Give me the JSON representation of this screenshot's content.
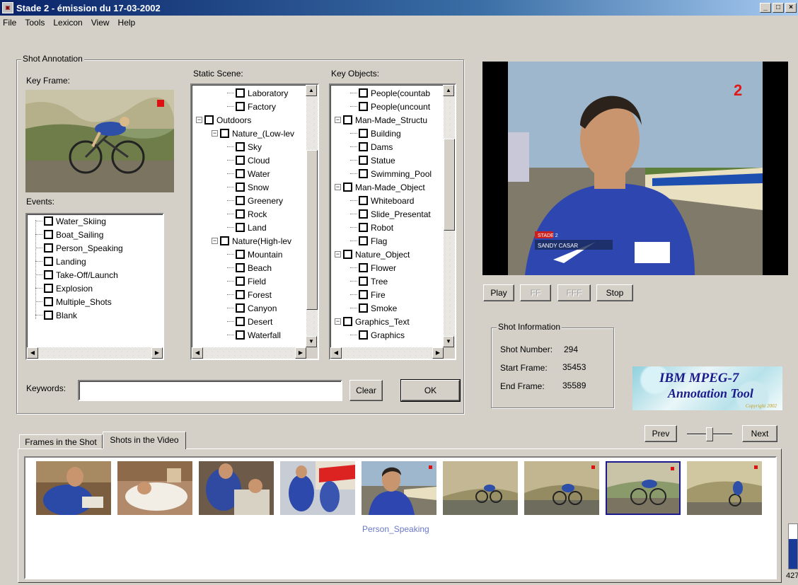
{
  "window": {
    "title": "Stade 2 - émission du 17-03-2002",
    "app_icon": "mpeg7-app-icon",
    "min_label": "_",
    "max_label": "□",
    "close_label": "×"
  },
  "menu": [
    "File",
    "Tools",
    "Lexicon",
    "View",
    "Help"
  ],
  "shot_annotation": {
    "legend": "Shot Annotation",
    "key_frame_label": "Key Frame:",
    "events_label": "Events:",
    "static_scene_label": "Static Scene:",
    "key_objects_label": "Key Objects:",
    "keywords_label": "Keywords:",
    "keywords_value": "",
    "clear_label": "Clear",
    "ok_label": "OK"
  },
  "events": [
    "Water_Skiing",
    "Boat_Sailing",
    "Person_Speaking",
    "Landing",
    "Take-Off/Launch",
    "Explosion",
    "Multiple_Shots",
    "Blank"
  ],
  "static_scene": [
    {
      "label": "Laboratory",
      "level": 2,
      "expander": false
    },
    {
      "label": "Factory",
      "level": 2,
      "expander": false
    },
    {
      "label": "Outdoors",
      "level": 0,
      "expander": true
    },
    {
      "label": "Nature_(Low-lev",
      "level": 1,
      "expander": true
    },
    {
      "label": "Sky",
      "level": 2,
      "expander": false
    },
    {
      "label": "Cloud",
      "level": 2,
      "expander": false
    },
    {
      "label": "Water",
      "level": 2,
      "expander": false
    },
    {
      "label": "Snow",
      "level": 2,
      "expander": false
    },
    {
      "label": "Greenery",
      "level": 2,
      "expander": false
    },
    {
      "label": "Rock",
      "level": 2,
      "expander": false
    },
    {
      "label": "Land",
      "level": 2,
      "expander": false
    },
    {
      "label": "Nature(High-lev",
      "level": 1,
      "expander": true
    },
    {
      "label": "Mountain",
      "level": 2,
      "expander": false
    },
    {
      "label": "Beach",
      "level": 2,
      "expander": false
    },
    {
      "label": "Field",
      "level": 2,
      "expander": false
    },
    {
      "label": "Forest",
      "level": 2,
      "expander": false
    },
    {
      "label": "Canyon",
      "level": 2,
      "expander": false
    },
    {
      "label": "Desert",
      "level": 2,
      "expander": false
    },
    {
      "label": "Waterfall",
      "level": 2,
      "expander": false
    }
  ],
  "key_objects": [
    {
      "label": "People(countab",
      "level": 1,
      "expander": false
    },
    {
      "label": "People(uncount",
      "level": 1,
      "expander": false
    },
    {
      "label": "Man-Made_Structu",
      "level": 0,
      "expander": true
    },
    {
      "label": "Building",
      "level": 1,
      "expander": false
    },
    {
      "label": "Dams",
      "level": 1,
      "expander": false
    },
    {
      "label": "Statue",
      "level": 1,
      "expander": false
    },
    {
      "label": "Swimming_Pool",
      "level": 1,
      "expander": false
    },
    {
      "label": "Man-Made_Object",
      "level": 0,
      "expander": true
    },
    {
      "label": "Whiteboard",
      "level": 1,
      "expander": false
    },
    {
      "label": "Slide_Presentat",
      "level": 1,
      "expander": false
    },
    {
      "label": "Robot",
      "level": 1,
      "expander": false
    },
    {
      "label": "Flag",
      "level": 1,
      "expander": false
    },
    {
      "label": "Nature_Object",
      "level": 0,
      "expander": true
    },
    {
      "label": "Flower",
      "level": 1,
      "expander": false
    },
    {
      "label": "Tree",
      "level": 1,
      "expander": false
    },
    {
      "label": "Fire",
      "level": 1,
      "expander": false
    },
    {
      "label": "Smoke",
      "level": 1,
      "expander": false
    },
    {
      "label": "Graphics_Text",
      "level": 0,
      "expander": true
    },
    {
      "label": "Graphics",
      "level": 1,
      "expander": false
    }
  ],
  "video": {
    "caption_tag": "STADE 2",
    "caption_name": "SANDY CASAR",
    "channel_logo": "2",
    "play_label": "Play",
    "ff_label": "FF",
    "fff_label": "FFF",
    "stop_label": "Stop"
  },
  "shot_info": {
    "legend": "Shot Information",
    "shot_number_label": "Shot Number:",
    "shot_number": "294",
    "start_frame_label": "Start Frame:",
    "start_frame": "35453",
    "end_frame_label": "End Frame:",
    "end_frame": "35589"
  },
  "logo": {
    "line1": "IBM MPEG-7",
    "line2": "Annotation Tool",
    "copyright": "Copyright 2002"
  },
  "tabs": [
    {
      "label": "Frames in the Shot",
      "active": false
    },
    {
      "label": "Shots in the Video",
      "active": true
    }
  ],
  "navigation": {
    "prev_label": "Prev",
    "next_label": "Next",
    "slider_value": 0.5
  },
  "shot_strip": {
    "selected_label": "Person_Speaking",
    "side_number": "427"
  }
}
